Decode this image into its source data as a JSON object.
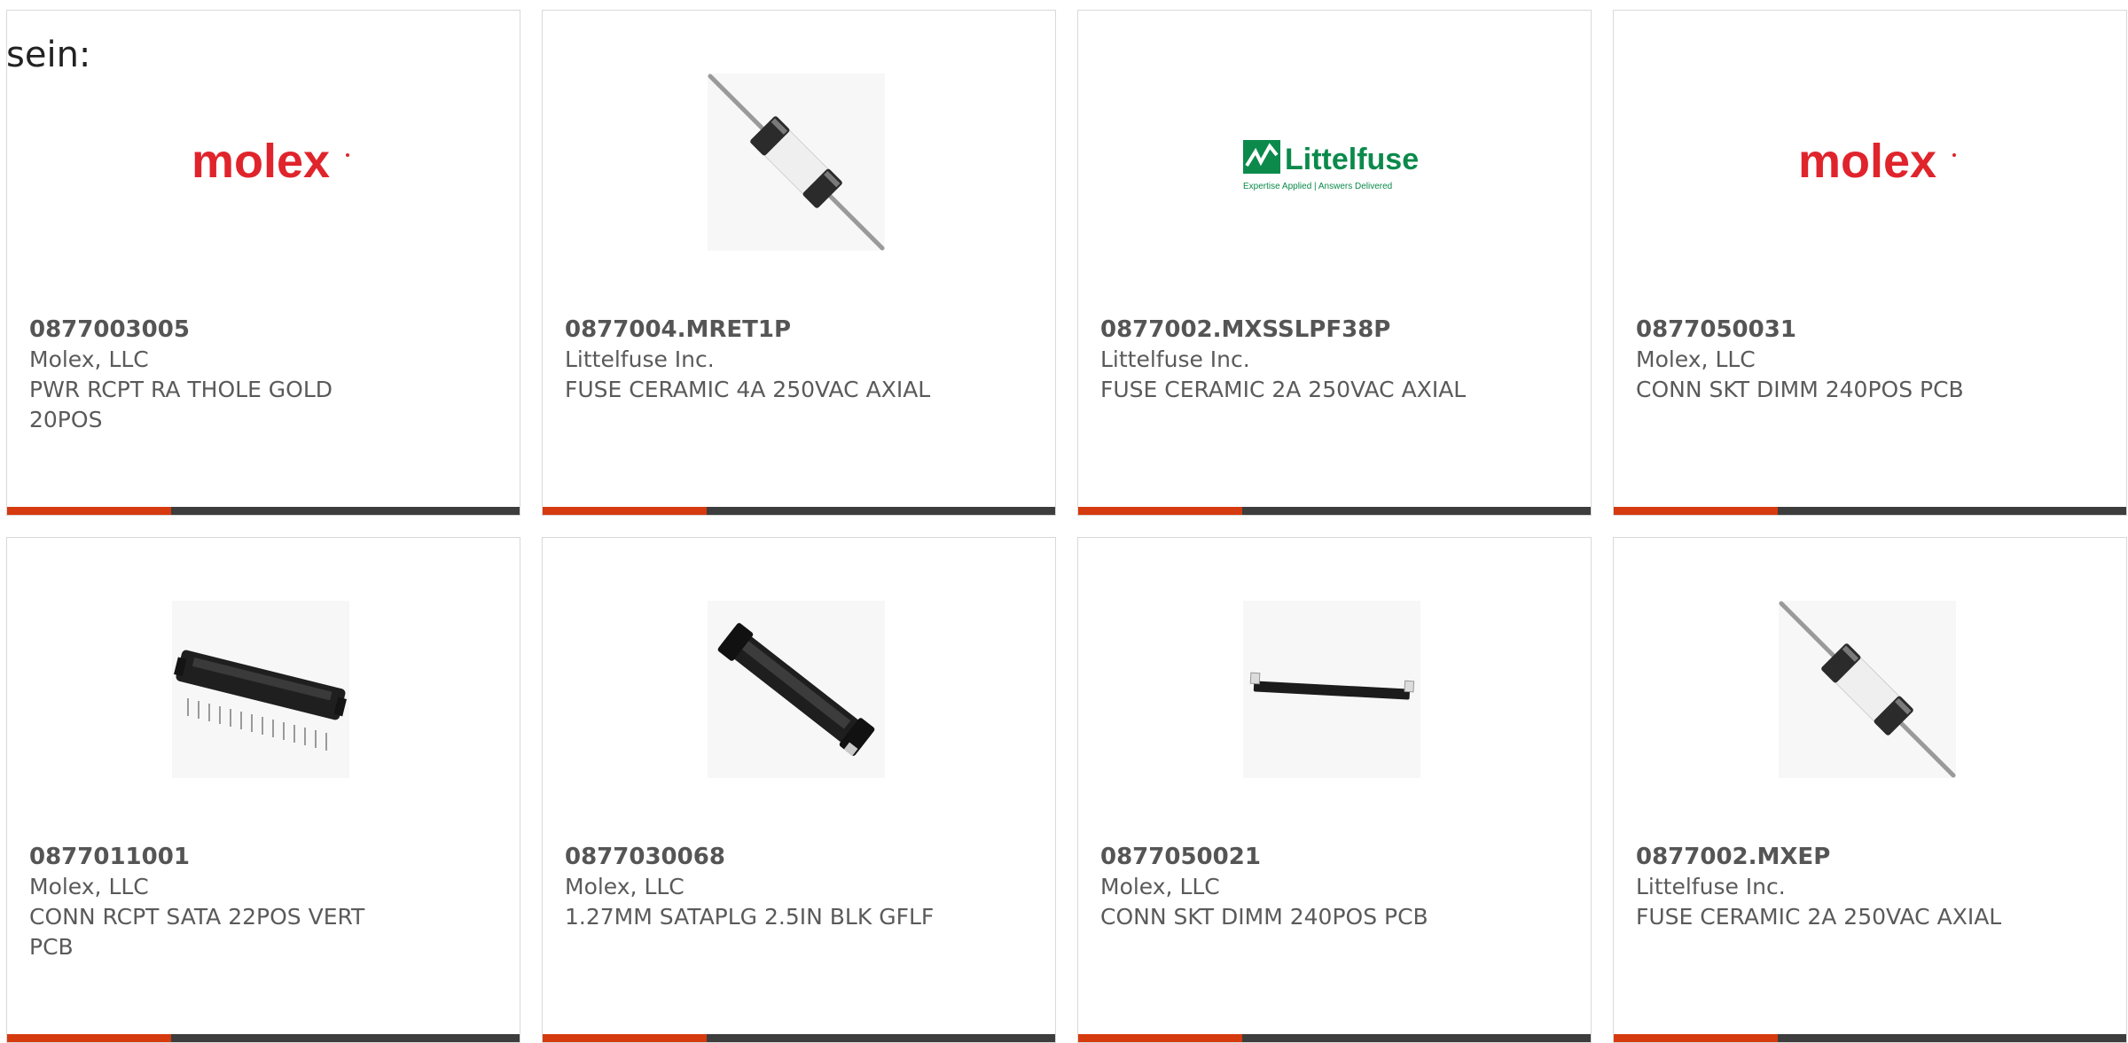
{
  "intro_text": "sein:",
  "colors": {
    "accent_bar": "#d63a0f",
    "dark_bar": "#3d3d3d",
    "molex_red": "#e0242c",
    "littelfuse_green": "#0b8a4b"
  },
  "products": [
    {
      "part_number": "0877003005",
      "manufacturer": "Molex, LLC",
      "description": "PWR RCPT RA THOLE GOLD 20POS",
      "image": "molex-logo",
      "logo_text": "molex",
      "accent_fraction": 0.32
    },
    {
      "part_number": "0877004.MRET1P",
      "manufacturer": "Littelfuse Inc.",
      "description": "FUSE CERAMIC 4A 250VAC AXIAL",
      "image": "axial-fuse",
      "accent_fraction": 0.32
    },
    {
      "part_number": "0877002.MXSSLPF38P",
      "manufacturer": "Littelfuse Inc.",
      "description": "FUSE CERAMIC 2A 250VAC AXIAL",
      "image": "littelfuse-logo",
      "logo_text": "Littelfuse",
      "logo_tagline": "Expertise Applied | Answers Delivered",
      "accent_fraction": 0.32
    },
    {
      "part_number": "0877050031",
      "manufacturer": "Molex, LLC",
      "description": "CONN SKT DIMM 240POS PCB",
      "image": "molex-logo",
      "logo_text": "molex",
      "accent_fraction": 0.32
    },
    {
      "part_number": "0877011001",
      "manufacturer": "Molex, LLC",
      "description": "CONN RCPT SATA 22POS VERT PCB",
      "image": "sata-connector",
      "accent_fraction": 0.32
    },
    {
      "part_number": "0877030068",
      "manufacturer": "Molex, LLC",
      "description": "1.27MM SATAPLG 2.5IN BLK GFLF",
      "image": "sata-plug",
      "accent_fraction": 0.32
    },
    {
      "part_number": "0877050021",
      "manufacturer": "Molex, LLC",
      "description": "CONN SKT DIMM 240POS PCB",
      "image": "dimm-socket",
      "accent_fraction": 0.32
    },
    {
      "part_number": "0877002.MXEP",
      "manufacturer": "Littelfuse Inc.",
      "description": "FUSE CERAMIC 2A 250VAC AXIAL",
      "image": "axial-fuse",
      "accent_fraction": 0.32
    }
  ]
}
